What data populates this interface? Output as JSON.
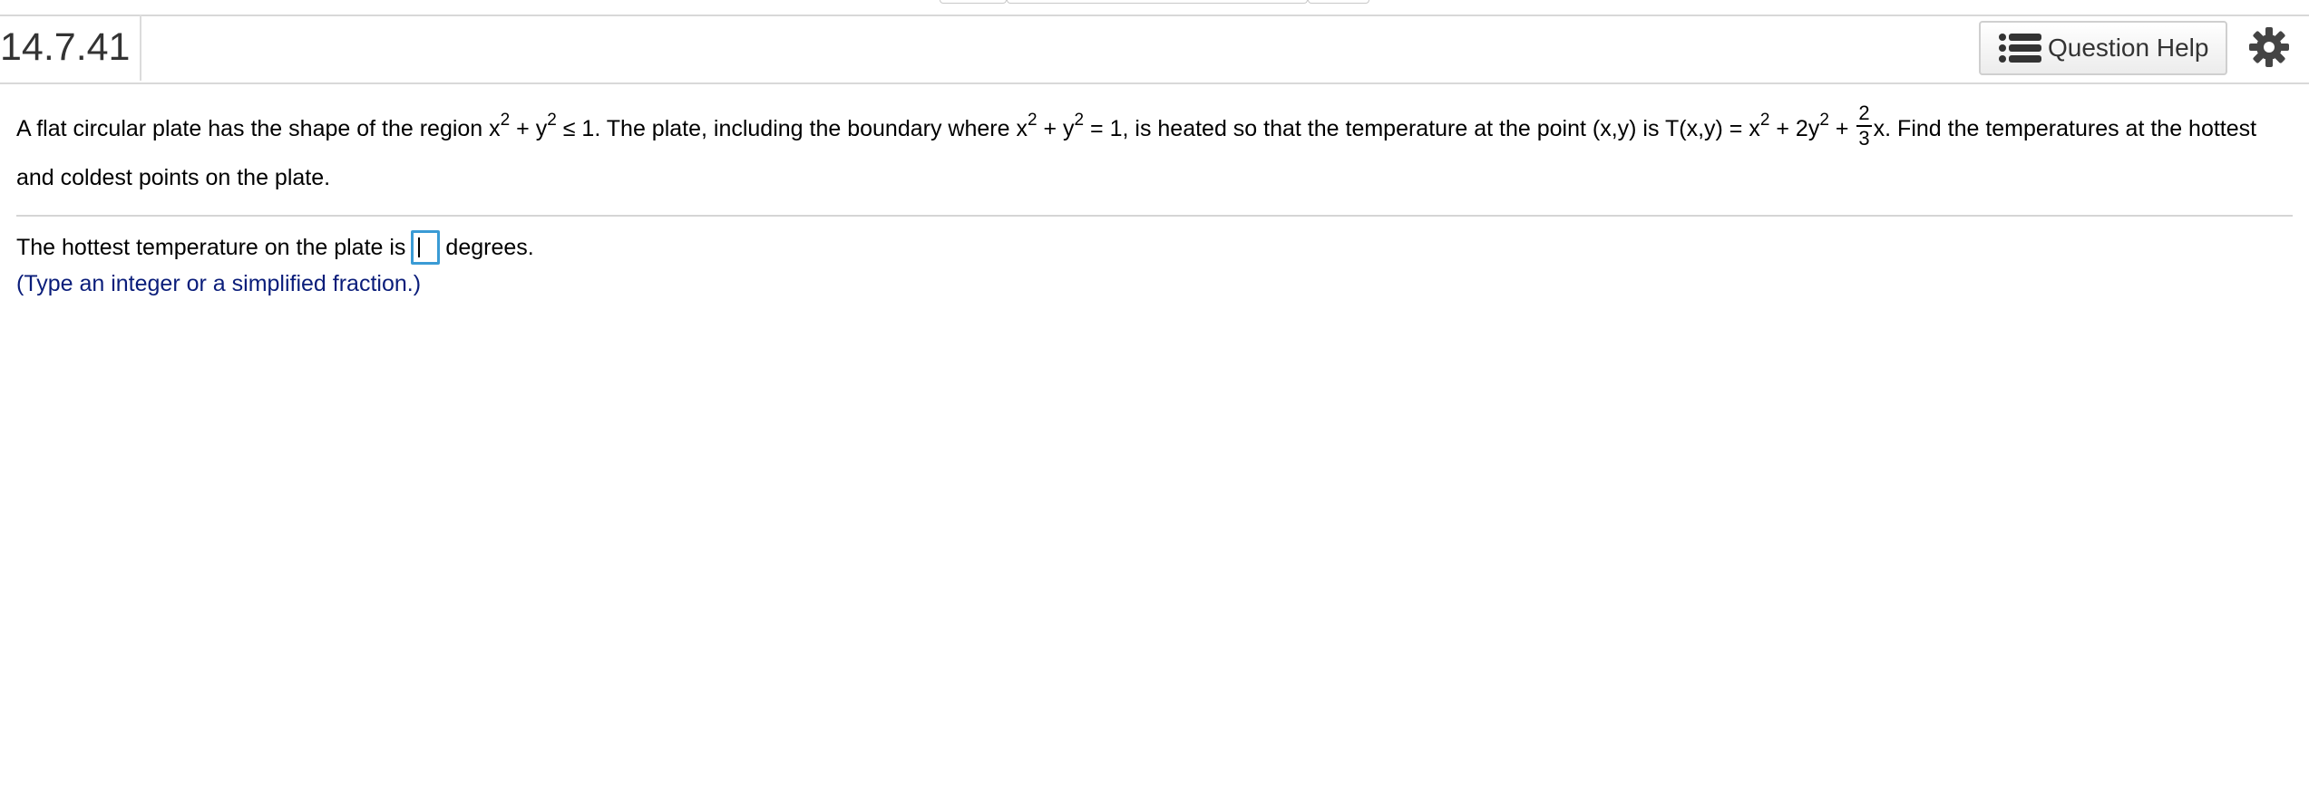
{
  "header": {
    "question_number": "14.7.41",
    "help_label": "Question Help"
  },
  "problem": {
    "p1": "A flat circular plate has the shape of the region x",
    "sup1": "2",
    "p2": " + y",
    "sup2": "2",
    "p3": " ≤ 1. The plate, including the boundary where x",
    "sup3": "2",
    "p4": " + y",
    "sup4": "2",
    "p5": " = 1, is heated so that the temperature at the point (x,y) is T(x,y) = x",
    "sup5": "2",
    "p6": " + 2y",
    "sup6": "2",
    "p7": " + ",
    "frac_num": "2",
    "frac_den": "3",
    "p8": "x. Find the temperatures at the hottest and coldest points on the plate."
  },
  "answer": {
    "prefix": "The hottest temperature on the plate is",
    "suffix": "degrees.",
    "value": "",
    "hint": "(Type an integer or a simplified fraction.)"
  },
  "colors": {
    "input_border": "#3a9bd5",
    "hint_text": "#0a1d7a"
  },
  "icons": [
    "list-icon",
    "gear-icon"
  ]
}
